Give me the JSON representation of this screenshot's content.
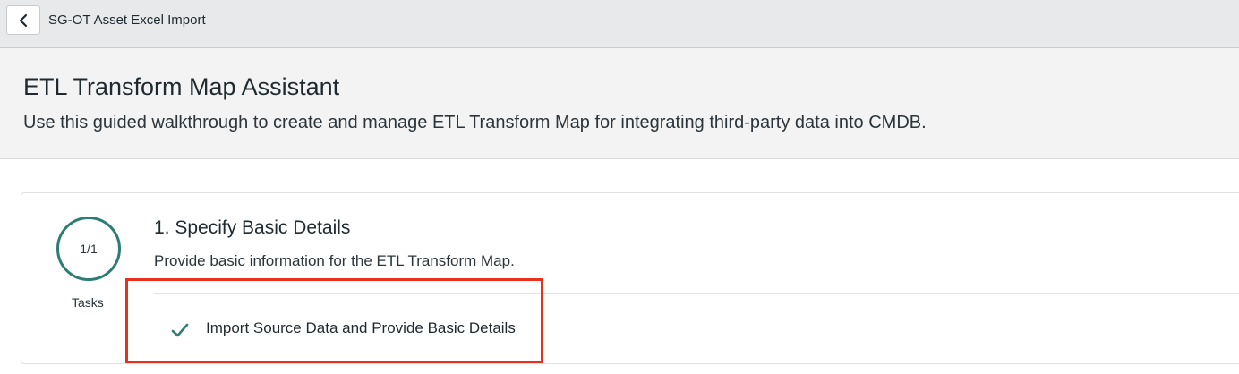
{
  "topbar": {
    "back_icon": "chevron-left-icon",
    "title": "SG-OT Asset Excel Import"
  },
  "header": {
    "title": "ETL Transform Map Assistant",
    "subtitle": "Use this guided walkthrough to create and manage ETL Transform Map for integrating third-party data into CMDB."
  },
  "step": {
    "progress_text": "1/1",
    "progress_label": "Tasks",
    "title": "1. Specify Basic Details",
    "description": "Provide basic information for the ETL Transform Map.",
    "accent_color": "#2e7d74",
    "tasks": [
      {
        "label": "Import Source Data and Provide Basic Details",
        "status": "completed",
        "icon": "checkmark-icon"
      }
    ]
  },
  "annotation": {
    "highlight_color": "#e8301f"
  }
}
